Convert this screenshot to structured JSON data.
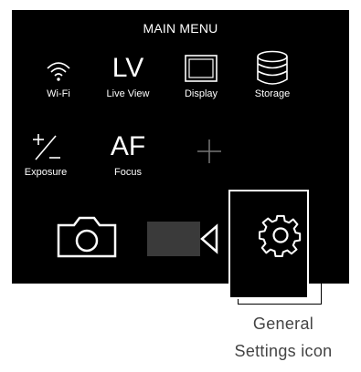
{
  "menu": {
    "title": "MAIN MENU",
    "items": [
      {
        "label": "Wi-Fi",
        "icon": "wifi-icon"
      },
      {
        "label": "Live View",
        "icon": "live-view-icon",
        "glyph": "LV"
      },
      {
        "label": "Display",
        "icon": "display-icon"
      },
      {
        "label": "Storage",
        "icon": "storage-icon"
      },
      {
        "label": "Exposure",
        "icon": "exposure-icon"
      },
      {
        "label": "Focus",
        "icon": "focus-icon",
        "glyph": "AF"
      },
      {
        "icon": "add-icon"
      }
    ],
    "modes": [
      {
        "icon": "camera-icon"
      },
      {
        "icon": "video-camera-icon"
      },
      {
        "icon": "gear-icon",
        "selected": true
      }
    ]
  },
  "caption": {
    "line1": "General",
    "line2": "Settings icon"
  },
  "colors": {
    "panel": "#000000",
    "foreground": "#ffffff",
    "caption": "#444444"
  }
}
